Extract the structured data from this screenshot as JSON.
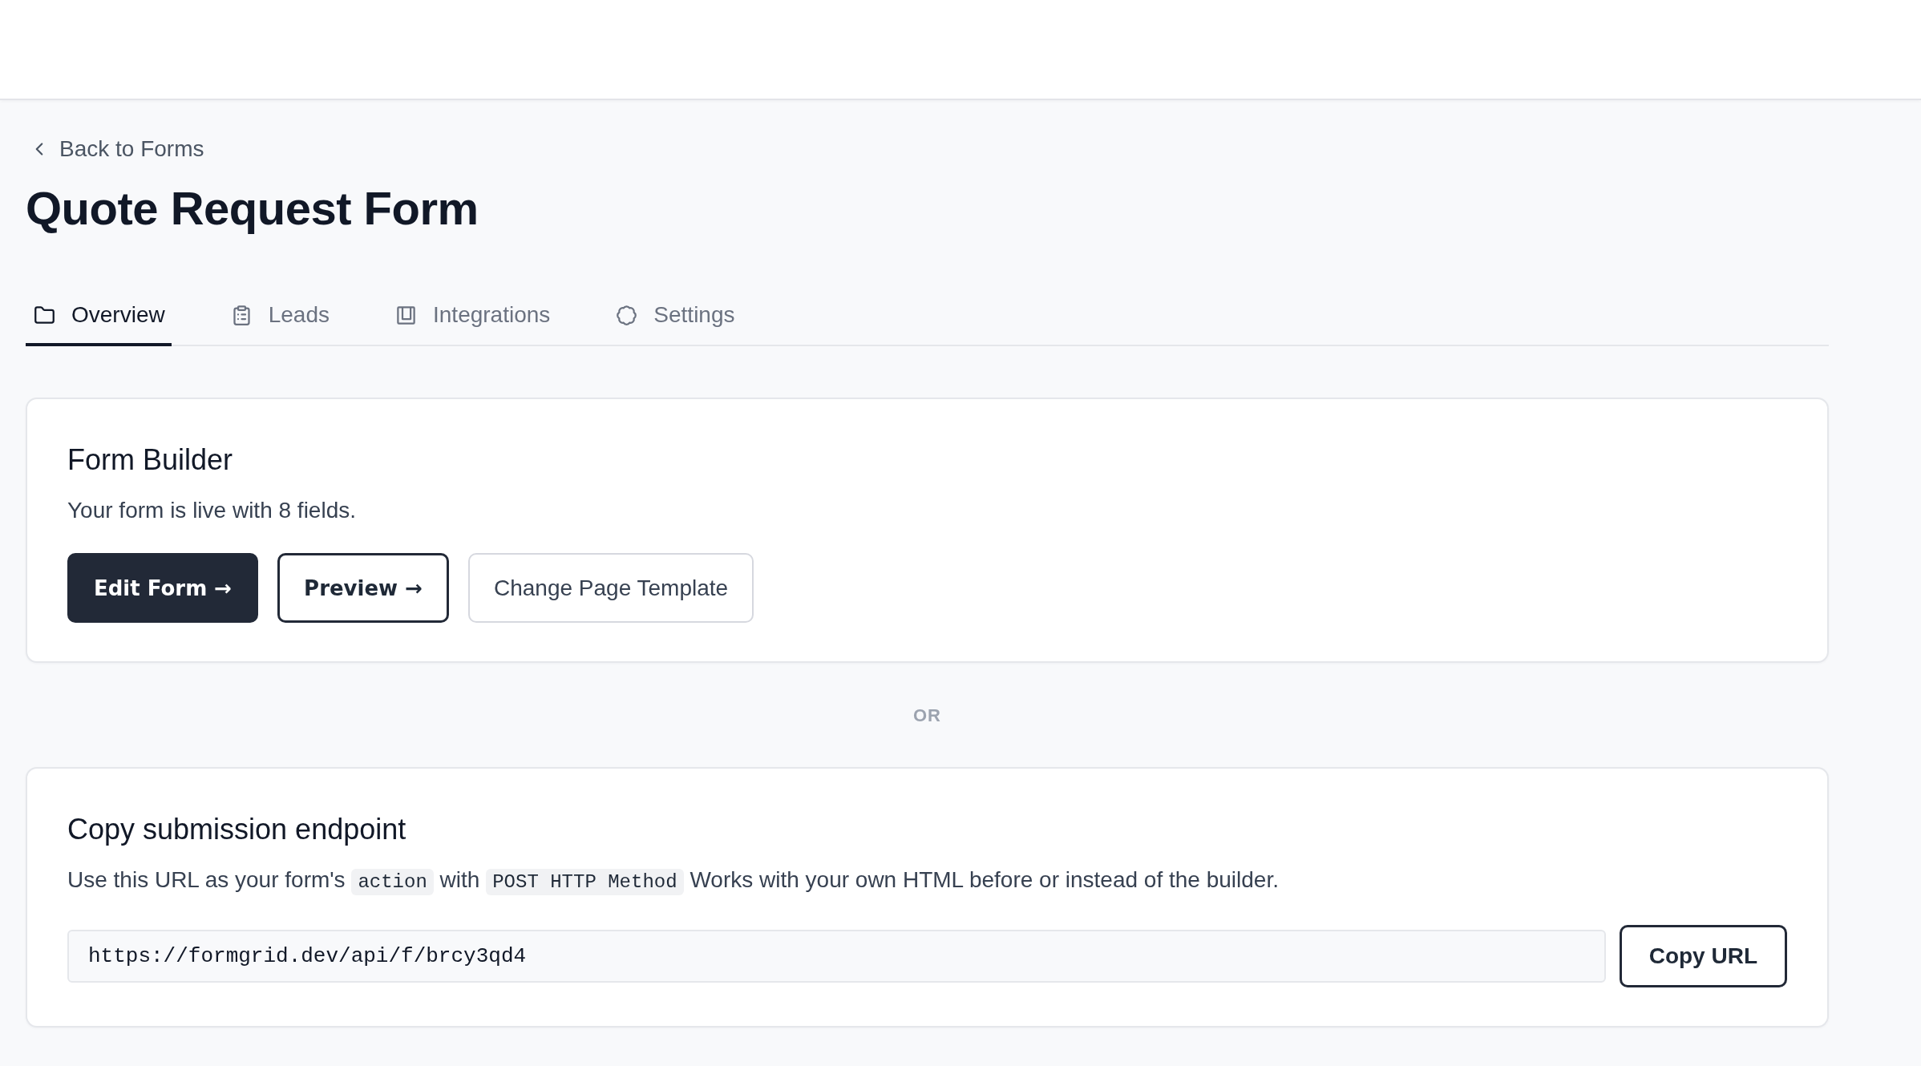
{
  "back_link": {
    "label": "Back to Forms"
  },
  "page_title": "Quote Request Form",
  "tabs": [
    {
      "label": "Overview",
      "selected": true
    },
    {
      "label": "Leads",
      "selected": false
    },
    {
      "label": "Integrations",
      "selected": false
    },
    {
      "label": "Settings",
      "selected": false
    }
  ],
  "form_builder": {
    "title": "Form Builder",
    "description": "Your form is live with 8 fields.",
    "buttons": [
      {
        "label": "Edit Form →",
        "kind": "primary"
      },
      {
        "label": "Preview →",
        "kind": "outline"
      },
      {
        "label": "Change Page Template",
        "kind": "secondary"
      }
    ]
  },
  "separator": {
    "label": "OR"
  },
  "endpoint": {
    "title": "Copy submission endpoint",
    "description": [
      {
        "kind": "text",
        "text": "Use this URL as your form's"
      },
      {
        "kind": "code",
        "text": "action"
      },
      {
        "kind": "text",
        "text": "with"
      },
      {
        "kind": "code",
        "text": "POST HTTP Method"
      },
      {
        "kind": "text",
        "text": "Works with your own HTML before or instead of the builder."
      }
    ],
    "url_field": {
      "value": "https://formgrid.dev/api/f/brcy3qd4"
    },
    "copy_button": {
      "label": "Copy URL"
    }
  }
}
